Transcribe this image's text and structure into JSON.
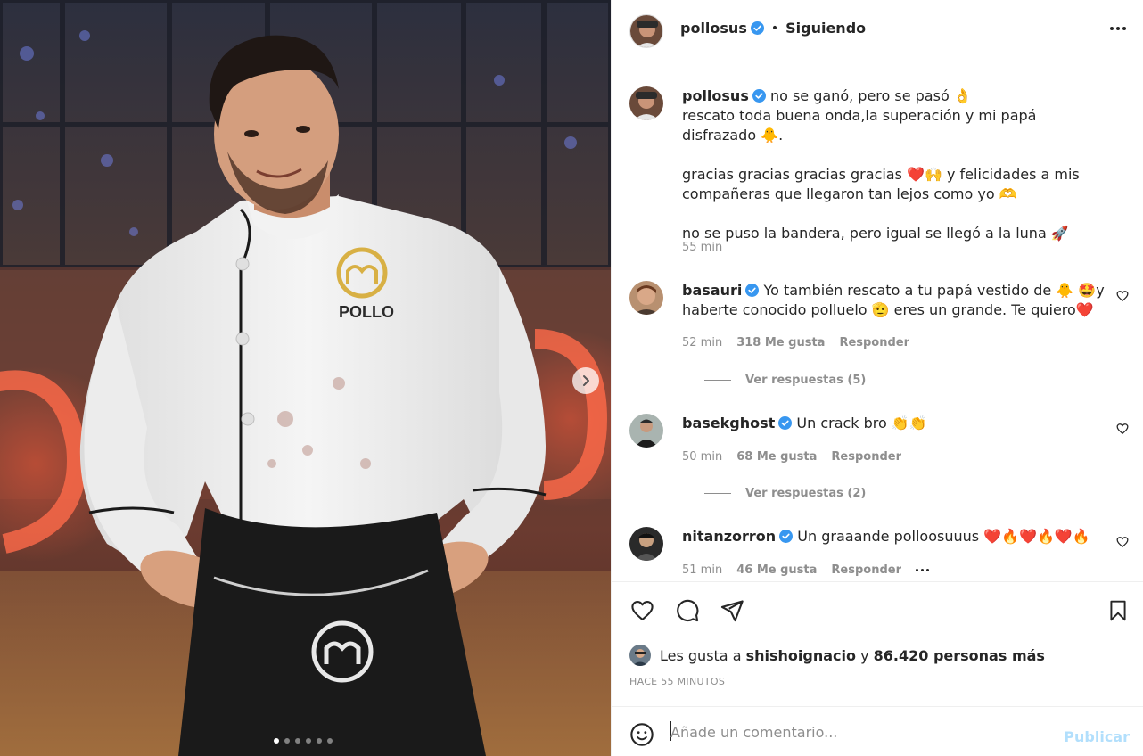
{
  "post": {
    "author": "pollosus",
    "follow_status": "Siguiendo",
    "separator": "•",
    "more_icon": "more-horizontal-icon",
    "carousel": {
      "total": 6,
      "active": 1
    },
    "caption": {
      "lines": [
        "no se ganó, pero se pasó 👌",
        "rescato toda buena onda,la superación y mi papá disfrazado 🐥.",
        "gracias gracias gracias gracias ❤️🙌 y felicidades a mis",
        "compañeras que llegaron tan lejos como yo 🫶",
        "no se puso la bandera, pero igual se llegó a la luna 🚀"
      ],
      "time": "55 min"
    }
  },
  "comments": [
    {
      "user": "basauri",
      "text_1": "Yo también rescato a tu papá vestido de 🐥 🤩y",
      "text_2": "haberte conocido polluelo 🫡 eres un grande. Te quiero❤️",
      "time": "52 min",
      "likes": "318 Me gusta",
      "reply": "Responder",
      "view_replies": "Ver respuestas (5)"
    },
    {
      "user": "basekghost",
      "text_1": "Un crack bro 👏👏",
      "time": "50 min",
      "likes": "68 Me gusta",
      "reply": "Responder",
      "view_replies": "Ver respuestas (2)"
    },
    {
      "user": "nitanzorron",
      "text_1": "Un graaande polloosuuus ❤️🔥❤️🔥❤️🔥",
      "time": "51 min",
      "likes": "46 Me gusta",
      "reply": "Responder"
    }
  ],
  "actions": {
    "like_icon": "heart-icon",
    "comment_icon": "comment-icon",
    "share_icon": "paper-plane-icon",
    "save_icon": "bookmark-icon"
  },
  "likes_summary": {
    "prefix": "Les gusta a",
    "user": "shishoignacio",
    "connector": "y",
    "others": "86.420 personas más"
  },
  "timestamp": "HACE 55 MINUTOS",
  "composer": {
    "placeholder": "Añade un comentario...",
    "publish_label": "Publicar"
  },
  "photo": {
    "jacket_badge": "POLLO"
  },
  "colors": {
    "verified": "#3897f0",
    "publish_disabled": "#b2dffc",
    "muted": "#8e8e8e"
  }
}
